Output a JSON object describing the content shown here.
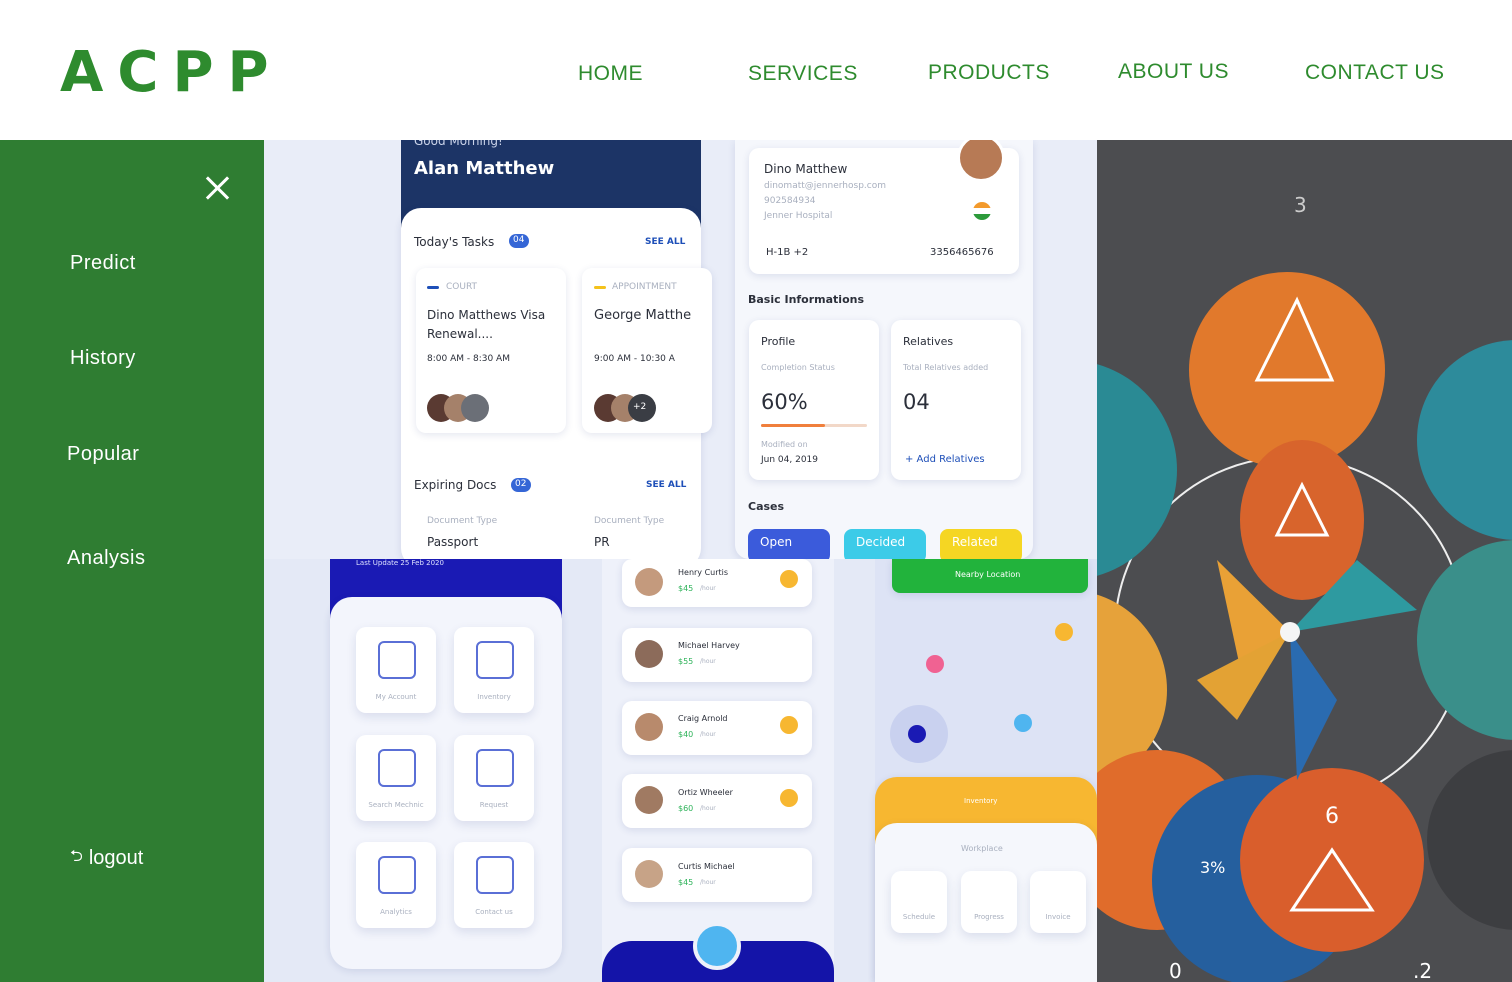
{
  "brand": {
    "logo": "ACPP",
    "color": "#2e8b2e"
  },
  "nav": {
    "items": [
      "HOME",
      "SERVICES",
      "PRODUCTS",
      "ABOUT US",
      "CONTACT US"
    ]
  },
  "sidebar": {
    "bg": "#2f7d32",
    "close_icon": "close-icon",
    "items": [
      "Predict",
      "History",
      "Popular",
      "Analysis"
    ],
    "logout": "logout",
    "logout_icon": "sign-out-icon"
  },
  "mock_app_1": {
    "greeting": "Good Morning!",
    "user": "Alan Matthew",
    "today_tasks": "Today's Tasks",
    "today_count": "04",
    "see_all": "SEE ALL",
    "task1_tag": "COURT",
    "task1_title_l1": "Dino Matthews Visa",
    "task1_title_l2": "Renewal....",
    "task1_time": "8:00 AM - 8:30 AM",
    "task2_tag": "APPOINTMENT",
    "task2_title": "George Matthe",
    "task2_time": "9:00 AM - 10:30 A",
    "task2_more": "+2",
    "expiring": "Expiring Docs",
    "expiring_count": "02",
    "doc_type": "Document Type",
    "doc1": "Passport",
    "doc2": "PR"
  },
  "mock_app_2": {
    "name": "Dino Matthew",
    "email": "dinomatt@jennerhosp.com",
    "phone": "902584934",
    "hospital": "Jenner Hospital",
    "visa": "H-1B +2",
    "id": "3356465676",
    "basic": "Basic Informations",
    "profile": "Profile",
    "completion": "Completion Status",
    "percent": "60%",
    "modified": "Modified on",
    "modified_date": "Jun 04, 2019",
    "relatives": "Relatives",
    "total_rel": "Total Relatives added",
    "rel_count": "04",
    "add_rel": "+ Add Relatives",
    "cases": "Cases",
    "open": "Open",
    "decided": "Decided",
    "related": "Related"
  },
  "mock_app_3": {
    "last_update": "Last Update 25 Feb 2020",
    "tiles": [
      "My Account",
      "Inventory",
      "Search Mechnic",
      "Request",
      "Analytics",
      "Contact us"
    ]
  },
  "mock_app_4": {
    "mechanics": [
      {
        "name": "Henry Curtis",
        "rate": "$45",
        "per": "/hour"
      },
      {
        "name": "Michael Harvey",
        "rate": "$55",
        "per": "/hour"
      },
      {
        "name": "Craig Arnold",
        "rate": "$40",
        "per": "/hour"
      },
      {
        "name": "Ortiz Wheeler",
        "rate": "$60",
        "per": "/hour"
      },
      {
        "name": "Curtis Michael",
        "rate": "$45",
        "per": "/hour"
      }
    ]
  },
  "mock_app_5": {
    "nearby": "Nearby Location",
    "inventory": "Inventory",
    "workplace": "Workplace",
    "icons": [
      "Schedule",
      "Progress",
      "Invoice"
    ]
  },
  "art_panel": {
    "labels": [
      "3",
      "6",
      "3%",
      "0",
      ".2"
    ]
  }
}
